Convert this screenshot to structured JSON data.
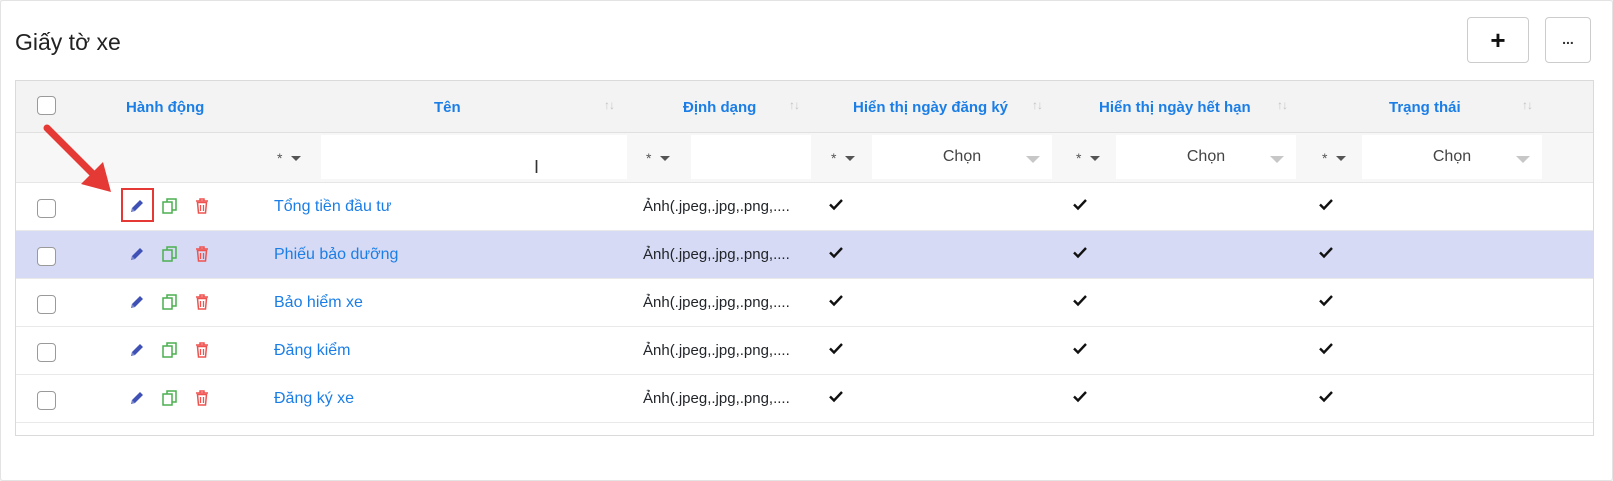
{
  "page": {
    "title": "Giấy tờ xe"
  },
  "toolbar": {
    "add_label": "+",
    "more_label": "..."
  },
  "table": {
    "columns": {
      "actions": "Hành động",
      "name": "Tên",
      "format": "Định dạng",
      "show_reg_date": "Hiển thị ngày đăng ký",
      "show_exp_date": "Hiển thị ngày hết hạn",
      "status": "Trạng thái"
    },
    "sort_symbol": "↑↓",
    "filters": {
      "operator": "*",
      "select_placeholder": "Chọn",
      "name_value": "",
      "format_value": ""
    },
    "rows": [
      {
        "name": "Tổng tiền đầu tư",
        "format": "Ảnh(.jpeg,.jpg,.png,....",
        "show_reg_date": true,
        "show_exp_date": true,
        "status": true
      },
      {
        "name": "Phiếu bảo dưỡng",
        "format": "Ảnh(.jpeg,.jpg,.png,....",
        "show_reg_date": true,
        "show_exp_date": true,
        "status": true
      },
      {
        "name": "Bảo hiểm xe",
        "format": "Ảnh(.jpeg,.jpg,.png,....",
        "show_reg_date": true,
        "show_exp_date": true,
        "status": true
      },
      {
        "name": "Đăng kiểm",
        "format": "Ảnh(.jpeg,.jpg,.png,....",
        "show_reg_date": true,
        "show_exp_date": true,
        "status": true
      },
      {
        "name": "Đăng ký xe",
        "format": "Ảnh(.jpeg,.jpg,.png,....",
        "show_reg_date": true,
        "show_exp_date": true,
        "status": true
      }
    ],
    "selected_row_index": 1
  },
  "colors": {
    "header_text": "#1b7ee6",
    "link": "#1b7ee6",
    "edit_icon": "#3f51b5",
    "copy_icon": "#4caf50",
    "delete_icon": "#ef5350",
    "selected_row": "#d6daf5",
    "annotation": "#e53935"
  },
  "icons": [
    "edit-icon",
    "copy-icon",
    "delete-icon",
    "check-icon",
    "sort-icon",
    "caret-down-icon",
    "plus-icon",
    "ellipsis-icon",
    "annotation-arrow-icon",
    "text-cursor-icon"
  ]
}
